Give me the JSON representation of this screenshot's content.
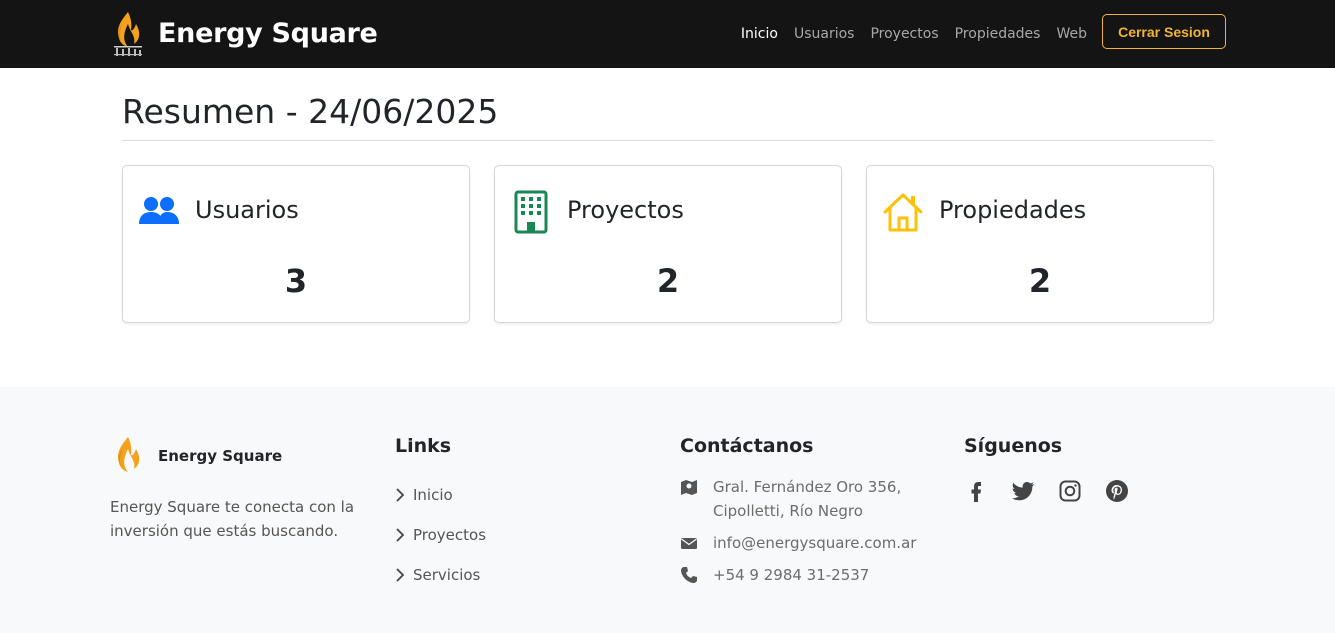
{
  "navbar": {
    "brand": "Energy Square",
    "links": [
      {
        "label": "Inicio"
      },
      {
        "label": "Usuarios"
      },
      {
        "label": "Proyectos"
      },
      {
        "label": "Propiedades"
      },
      {
        "label": "Web"
      }
    ],
    "logout_label": "Cerrar Sesion"
  },
  "main": {
    "title": "Resumen - 24/06/2025",
    "cards": [
      {
        "label": "Usuarios",
        "value": "3",
        "icon": "users-icon",
        "color": "#0d6efd"
      },
      {
        "label": "Proyectos",
        "value": "2",
        "icon": "building-icon",
        "color": "#198754"
      },
      {
        "label": "Propiedades",
        "value": "2",
        "icon": "house-icon",
        "color": "#ffc107"
      }
    ]
  },
  "footer": {
    "brand": "Energy Square",
    "description": "Energy Square te conecta con la inversión que estás buscando.",
    "links_title": "Links",
    "links": [
      "Inicio",
      "Proyectos",
      "Servicios"
    ],
    "contact_title": "Contáctanos",
    "address_line1": "Gral. Fernández Oro 356,",
    "address_line2": "Cipolletti, Río Negro",
    "email": "info@energysquare.com.ar",
    "phone": "+54 9 2984 31-2537",
    "social_title": "Síguenos",
    "social": [
      "facebook-icon",
      "twitter-icon",
      "instagram-icon",
      "pinterest-icon"
    ]
  },
  "colors": {
    "navbar_bg": "#141414",
    "accent": "#f2b531",
    "footer_bg": "#f8f9fa"
  }
}
